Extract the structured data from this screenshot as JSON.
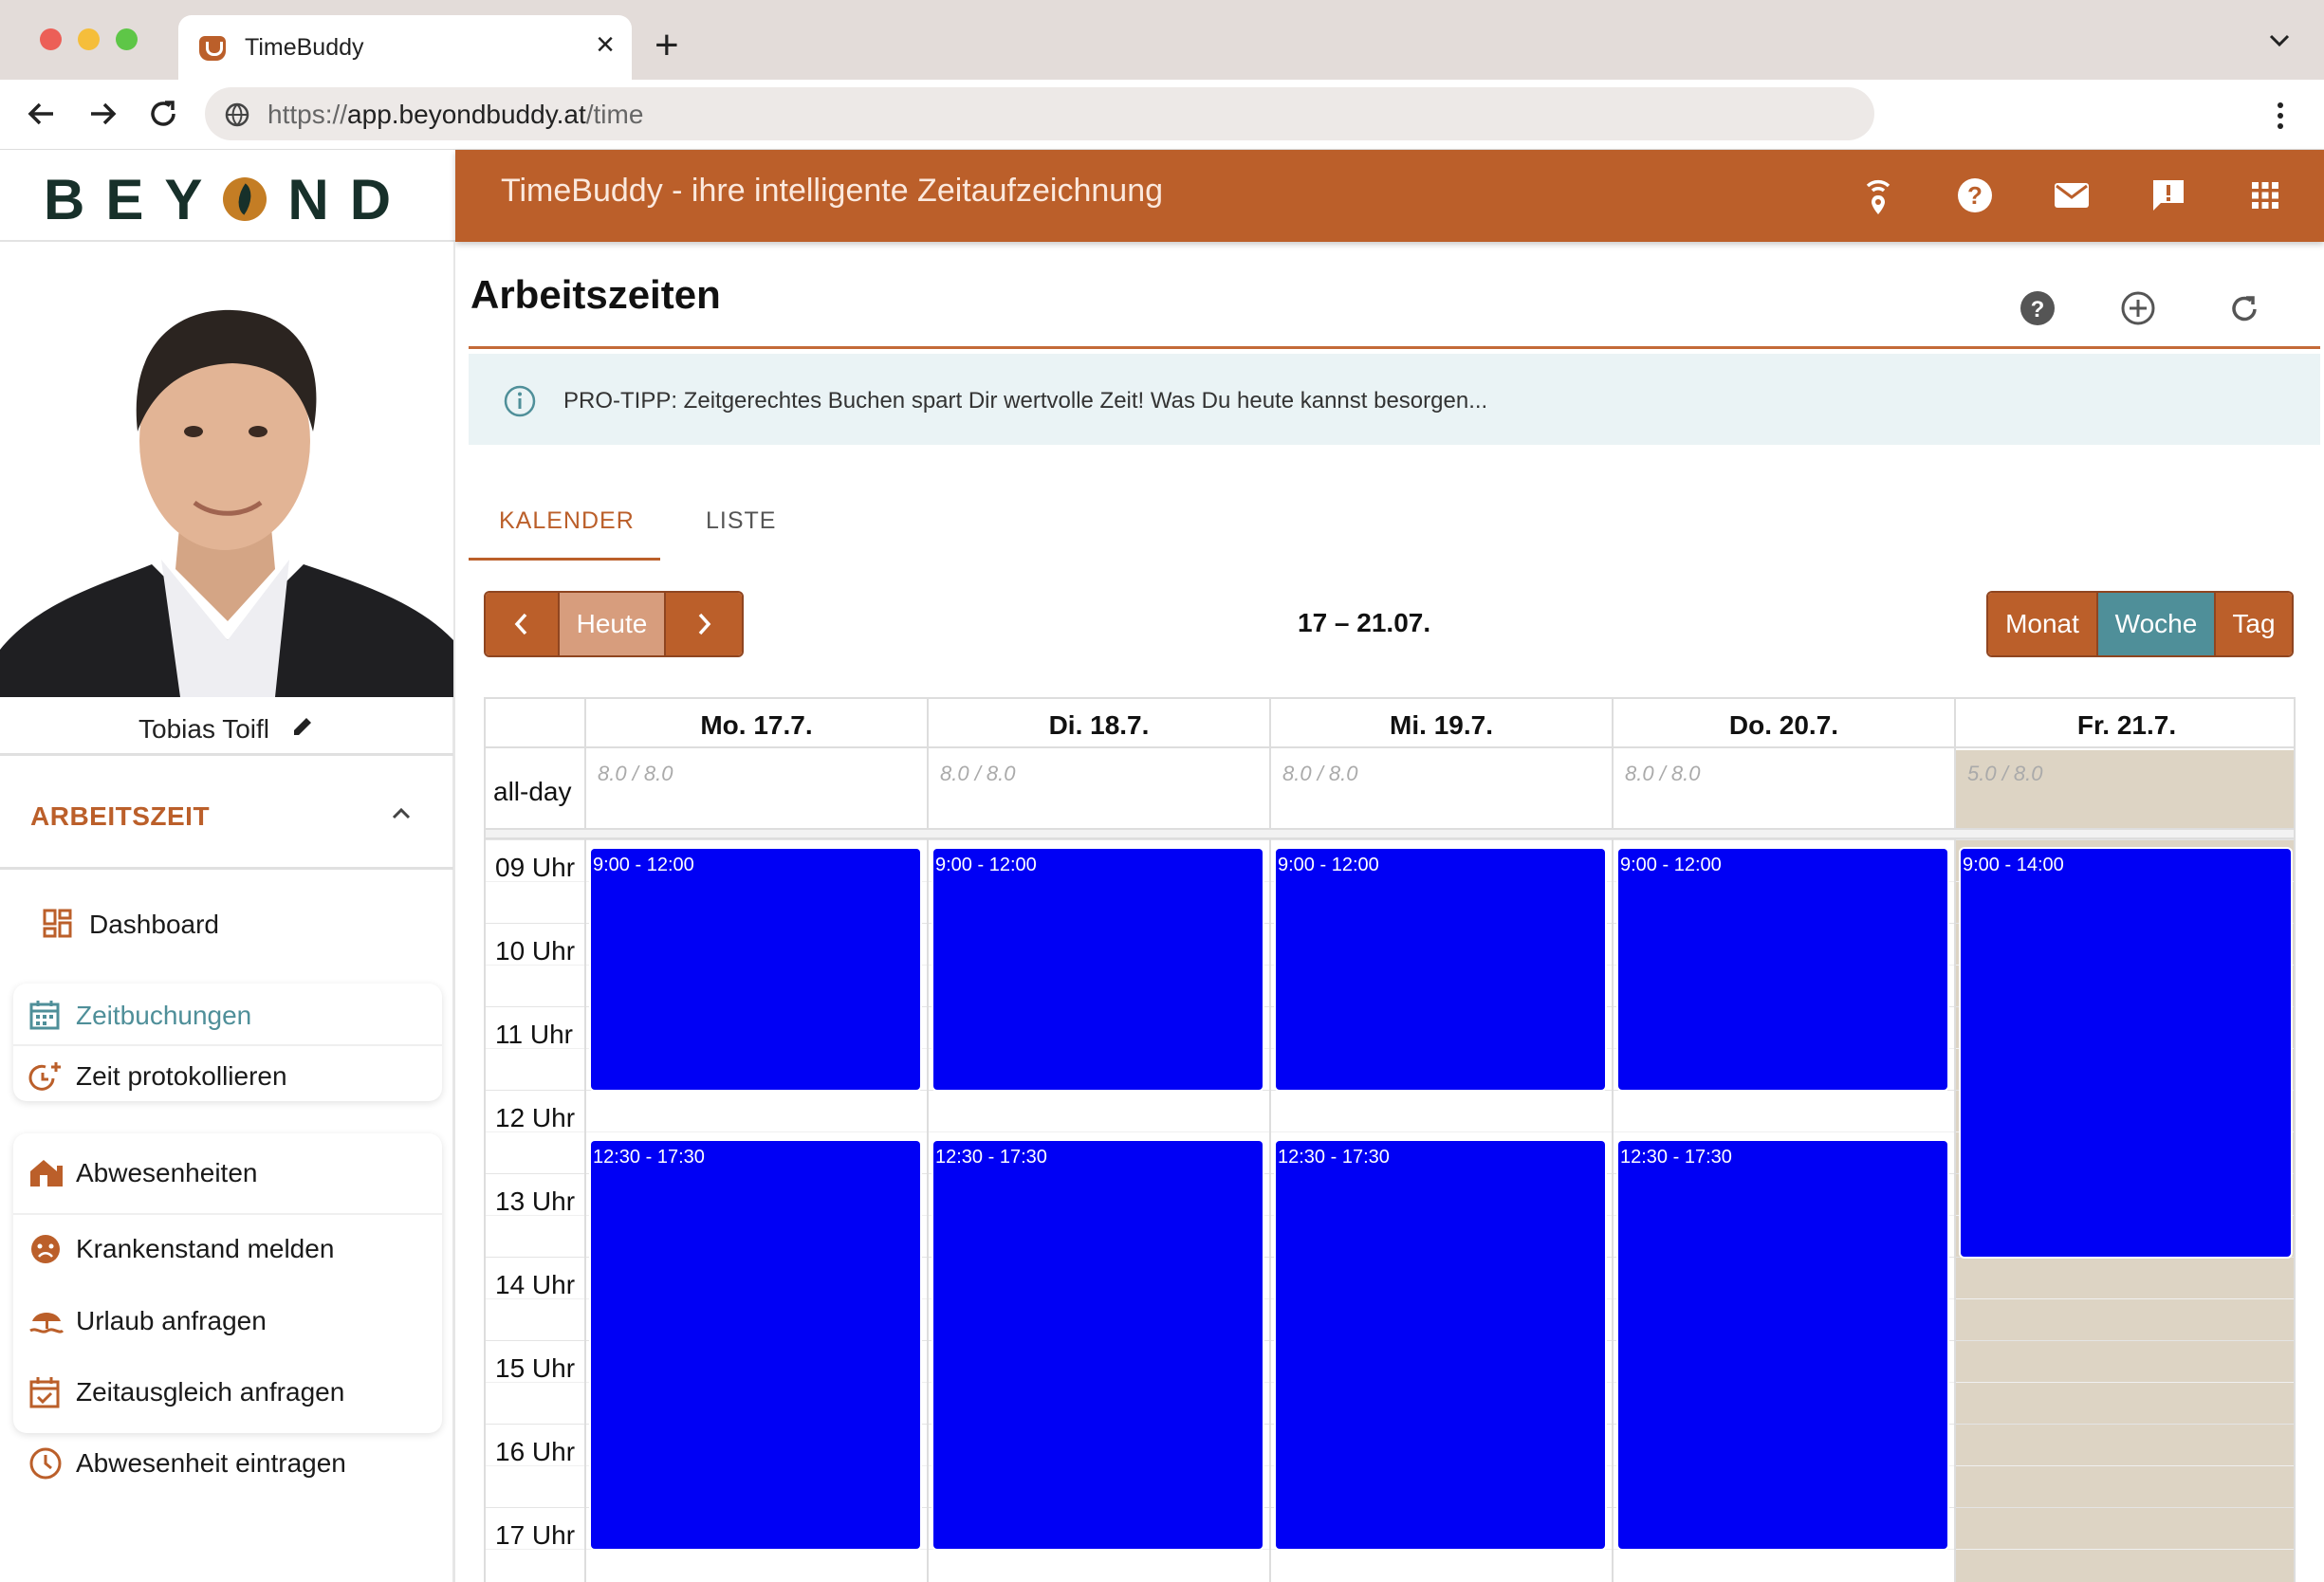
{
  "browser": {
    "tab_title": "TimeBuddy",
    "url_scheme": "https://",
    "url_host": "app.beyondbuddy.at",
    "url_path": "/time"
  },
  "header": {
    "brand_left": "BEY",
    "brand_right": "ND",
    "title": "TimeBuddy - ihre intelligente Zeitaufzeichnung",
    "colors": {
      "accent": "#bb5f2a",
      "teal": "#4f8f99",
      "event": "#0000f5"
    }
  },
  "sidebar": {
    "user_name": "Tobias Toifl",
    "section_title": "ARBEITSZEIT",
    "dashboard": "Dashboard",
    "group1": [
      "Zeitbuchungen",
      "Zeit protokollieren"
    ],
    "group2": [
      "Abwesenheiten",
      "Krankenstand melden",
      "Urlaub anfragen",
      "Zeitausgleich anfragen",
      "Abwesenheit eintragen"
    ]
  },
  "main": {
    "page_title": "Arbeitszeiten",
    "tip": "PRO-TIPP: Zeitgerechtes Buchen spart Dir wertvolle Zeit! Was Du heute kannst besorgen...",
    "tabs": [
      "KALENDER",
      "LISTE"
    ],
    "today_label": "Heute",
    "range": "17 – 21.07.",
    "views": [
      "Monat",
      "Woche",
      "Tag"
    ]
  },
  "calendar": {
    "days": [
      "Mo. 17.7.",
      "Di. 18.7.",
      "Mi. 19.7.",
      "Do. 20.7.",
      "Fr. 21.7."
    ],
    "allday_label": "all-day",
    "allday_values": [
      "8.0 / 8.0",
      "8.0 / 8.0",
      "8.0 / 8.0",
      "8.0 / 8.0",
      "5.0 / 8.0"
    ],
    "hours": [
      "09 Uhr",
      "10 Uhr",
      "11 Uhr",
      "12 Uhr",
      "13 Uhr",
      "14 Uhr",
      "15 Uhr",
      "16 Uhr",
      "17 Uhr"
    ],
    "events": [
      {
        "day": 0,
        "start": 9.0,
        "end": 12.0,
        "label": "9:00 - 12:00"
      },
      {
        "day": 1,
        "start": 9.0,
        "end": 12.0,
        "label": "9:00 - 12:00"
      },
      {
        "day": 2,
        "start": 9.0,
        "end": 12.0,
        "label": "9:00 - 12:00"
      },
      {
        "day": 3,
        "start": 9.0,
        "end": 12.0,
        "label": "9:00 - 12:00"
      },
      {
        "day": 4,
        "start": 9.0,
        "end": 14.0,
        "label": "9:00 - 14:00"
      },
      {
        "day": 0,
        "start": 12.5,
        "end": 17.5,
        "label": "12:30 - 17:30"
      },
      {
        "day": 1,
        "start": 12.5,
        "end": 17.5,
        "label": "12:30 - 17:30"
      },
      {
        "day": 2,
        "start": 12.5,
        "end": 17.5,
        "label": "12:30 - 17:30"
      },
      {
        "day": 3,
        "start": 12.5,
        "end": 17.5,
        "label": "12:30 - 17:30"
      }
    ]
  }
}
